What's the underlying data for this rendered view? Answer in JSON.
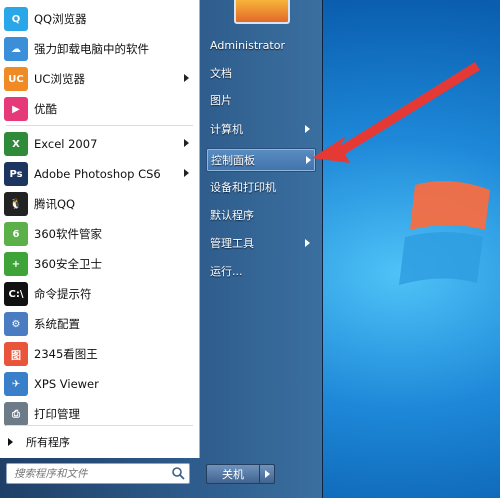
{
  "desktop": {
    "accent": "#1e88d8"
  },
  "left_menu": {
    "items": [
      {
        "label": "QQ浏览器",
        "icon": "qq-browser-icon",
        "color": "#2aa7e8",
        "glyph": "Q",
        "arrow": false
      },
      {
        "label": "强力卸载电脑中的软件",
        "icon": "uninstall-icon",
        "color": "#3b8fd9",
        "glyph": "☁",
        "arrow": false
      },
      {
        "label": "UC浏览器",
        "icon": "uc-browser-icon",
        "color": "#f08a24",
        "glyph": "UC",
        "arrow": true
      },
      {
        "label": "优酷",
        "icon": "youku-icon",
        "color": "#e5397a",
        "glyph": "▶",
        "arrow": false
      },
      {
        "label": "Excel 2007",
        "icon": "excel-icon",
        "color": "#2f8a3a",
        "glyph": "X",
        "arrow": true
      },
      {
        "label": "Adobe Photoshop CS6",
        "icon": "photoshop-icon",
        "color": "#1b3560",
        "glyph": "Ps",
        "arrow": true
      },
      {
        "label": "腾讯QQ",
        "icon": "qq-penguin-icon",
        "color": "#222222",
        "glyph": "🐧",
        "arrow": false
      },
      {
        "label": "360软件管家",
        "icon": "360-software-icon",
        "color": "#5bb04a",
        "glyph": "6",
        "arrow": false
      },
      {
        "label": "360安全卫士",
        "icon": "360-security-icon",
        "color": "#3ea43a",
        "glyph": "+",
        "arrow": false
      },
      {
        "label": "命令提示符",
        "icon": "cmd-icon",
        "color": "#111111",
        "glyph": "C:\\",
        "arrow": false
      },
      {
        "label": "系统配置",
        "icon": "system-config-icon",
        "color": "#4a7cc2",
        "glyph": "⚙",
        "arrow": false
      },
      {
        "label": "2345看图王",
        "icon": "2345-viewer-icon",
        "color": "#e8553a",
        "glyph": "图",
        "arrow": false
      },
      {
        "label": "XPS Viewer",
        "icon": "xps-viewer-icon",
        "color": "#3a7fc9",
        "glyph": "✈",
        "arrow": false
      },
      {
        "label": "打印管理",
        "icon": "print-manager-icon",
        "color": "#6d7a88",
        "glyph": "⎙",
        "arrow": false
      }
    ],
    "all_programs": "所有程序",
    "search_placeholder": "搜索程序和文件"
  },
  "right_menu": {
    "items": [
      {
        "label": "Administrator",
        "arrow": false,
        "highlight": false
      },
      {
        "label": "文档",
        "arrow": false,
        "highlight": false
      },
      {
        "label": "图片",
        "arrow": false,
        "highlight": false
      },
      {
        "label": "计算机",
        "arrow": true,
        "highlight": false
      },
      {
        "label": "控制面板",
        "arrow": true,
        "highlight": true
      },
      {
        "label": "设备和打印机",
        "arrow": false,
        "highlight": false
      },
      {
        "label": "默认程序",
        "arrow": false,
        "highlight": false
      },
      {
        "label": "管理工具",
        "arrow": true,
        "highlight": false
      },
      {
        "label": "运行...",
        "arrow": false,
        "highlight": false
      }
    ],
    "shutdown_label": "关机"
  },
  "annotation": {
    "color": "#e53935"
  }
}
